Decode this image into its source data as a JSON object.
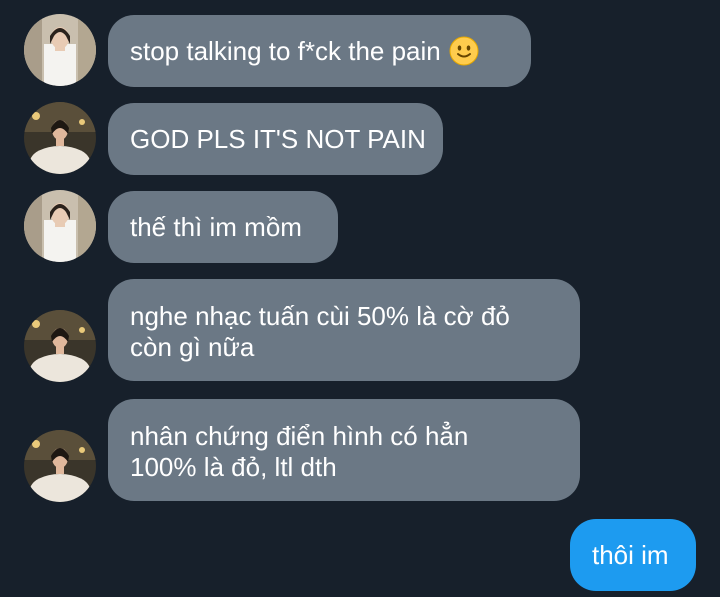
{
  "conversation": {
    "messages": [
      {
        "sender": "contact-a",
        "text": "stop talking to f*ck the pain",
        "emoji": "slightly-smiling-face-icon"
      },
      {
        "sender": "contact-b",
        "text": "GOD PLS IT'S NOT PAIN"
      },
      {
        "sender": "contact-a",
        "text": "thế thì im mồm"
      },
      {
        "sender": "contact-b",
        "lines": [
          "nghe nhạc tuấn cùi 50% là cờ đỏ",
          "còn gì nữa"
        ]
      },
      {
        "sender": "contact-b",
        "lines": [
          "nhân chứng điển hình có hẳn",
          "100% là đỏ, ltl dth"
        ]
      },
      {
        "sender": "me",
        "text": "thôi im"
      }
    ]
  },
  "colors": {
    "background": "#17202b",
    "incoming_bubble": "#6b7885",
    "outgoing_bubble": "#1d9bf0",
    "text": "#ffffff"
  }
}
